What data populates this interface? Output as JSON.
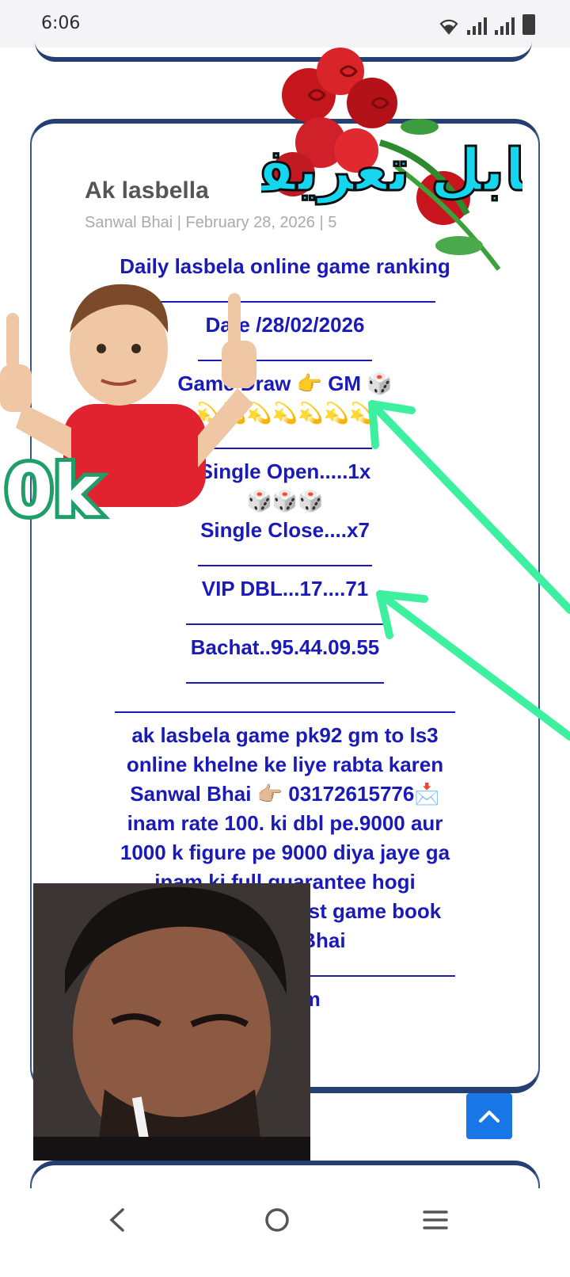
{
  "status_bar": {
    "time": "6:06",
    "icons": [
      "wifi-icon",
      "signal-icon",
      "signal-icon",
      "battery-icon"
    ]
  },
  "post": {
    "title": "Ak lasbella",
    "meta": "Sanwal Bhai | February 28, 2026 | 5",
    "lines": [
      {
        "type": "text",
        "text": "Daily lasbela online game ranking"
      },
      {
        "type": "sep",
        "width": 380
      },
      {
        "type": "text",
        "text": "Date /28/02/2026"
      },
      {
        "type": "sep",
        "width": 220
      },
      {
        "type": "text",
        "text": "Game Draw 👉 GM 🎲"
      },
      {
        "type": "text",
        "text": "💫💫💫💫💫💫💫"
      },
      {
        "type": "sep",
        "width": 220
      },
      {
        "type": "text",
        "text": "Single Open.....1x"
      },
      {
        "type": "text",
        "text": "🎲🎲🎲"
      },
      {
        "type": "text",
        "text": "Single Close....x7"
      },
      {
        "type": "sep",
        "width": 220
      },
      {
        "type": "text",
        "text": "VIP DBL...17....71"
      },
      {
        "type": "sep",
        "width": 250
      },
      {
        "type": "text",
        "text": "Bachat..95.44.09.55"
      },
      {
        "type": "sep",
        "width": 250
      },
      {
        "type": "sep",
        "width": 430
      },
      {
        "type": "text",
        "text": "ak lasbela game pk92 gm to ls3"
      },
      {
        "type": "text",
        "text": "online khelne ke liye rabta karen"
      },
      {
        "type": "text",
        "text": "Sanwal Bhai 👉🏼 03172615776📩"
      },
      {
        "type": "text",
        "text": "inam rate 100. ki dbl pe.9000 aur"
      },
      {
        "type": "text",
        "text": "1000 k figure pe 9000 diya jaye ga"
      },
      {
        "type": "text",
        "text": "inam ki full guarantee hogi"
      },
      {
        "type": "text",
        "text": "pk92 Gm se ls3 best game book"
      },
      {
        "type": "text",
        "text": "Sanwal Bhai"
      },
      {
        "type": "sep",
        "width": 430
      },
      {
        "type": "text",
        "text": "ak.com"
      }
    ]
  },
  "stickers": {
    "roses_caption": "قابل تعریف",
    "ok_caption": "0k"
  },
  "colors": {
    "accent": "#243f72",
    "post_text": "#1a1ab8",
    "arrow": "#3df0a0",
    "scroll_button": "#1976e6"
  },
  "scroll_top_icon": "chevron-up-icon",
  "nav_icons": [
    "back-icon",
    "home-icon",
    "menu-icon"
  ]
}
